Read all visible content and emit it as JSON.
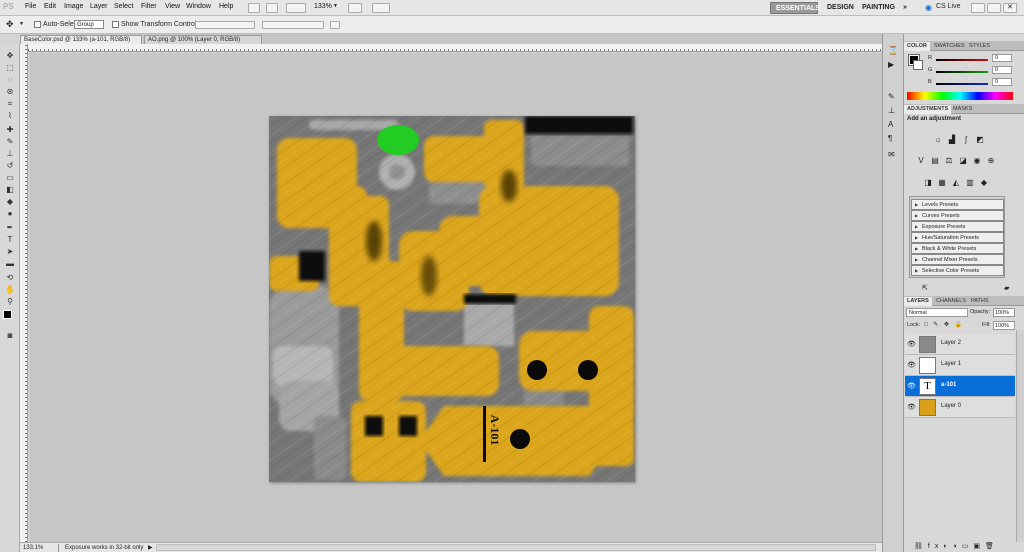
{
  "app": {
    "logo": "PS"
  },
  "menu": [
    "File",
    "Edit",
    "Image",
    "Layer",
    "Select",
    "Filter",
    "View",
    "Window",
    "Help"
  ],
  "zoom_dropdown": "133%",
  "workspaces": [
    "ESSENTIALS",
    "DESIGN",
    "PAINTING"
  ],
  "workspace_more": "»",
  "cs_live": "CS Live",
  "options": {
    "auto_select_label": "Auto-Select:",
    "auto_select_value": "Group",
    "transform_label": "Show Transform Controls"
  },
  "tabs": [
    "BaseColor.psd @ 133% (a-101, RGB/8)",
    "AO.png @ 100% (Layer 0, RGB/8)"
  ],
  "status": {
    "zoom": "133.1%",
    "message": "Exposure works in 32-bit only"
  },
  "color_panel": {
    "tabs": [
      "COLOR",
      "SWATCHES",
      "STYLES"
    ],
    "channels": [
      {
        "label": "R",
        "value": "0",
        "color": "#d01010"
      },
      {
        "label": "G",
        "value": "0",
        "color": "#10a010"
      },
      {
        "label": "B",
        "value": "0",
        "color": "#1030d0"
      }
    ]
  },
  "adjustments_panel": {
    "tabs": [
      "ADJUSTMENTS",
      "MASKS"
    ],
    "heading": "Add an adjustment",
    "icon_rows": [
      [
        "brightness-icon",
        "levels-icon",
        "curves-icon",
        "exposure-icon"
      ],
      [
        "vibrance-icon",
        "hue-sat-icon",
        "color-balance-icon",
        "black-white-icon",
        "photo-filter-icon",
        "channel-mixer-icon"
      ],
      [
        "invert-icon",
        "posterize-icon",
        "threshold-icon",
        "gradient-map-icon",
        "selective-color-icon"
      ]
    ],
    "presets": [
      "Levels Presets",
      "Curves Presets",
      "Exposure Presets",
      "Hue/Saturation Presets",
      "Black & White Presets",
      "Channel Mixer Presets",
      "Selective Color Presets"
    ]
  },
  "layers_panel": {
    "tabs": [
      "LAYERS",
      "CHANNELS",
      "PATHS"
    ],
    "blend_mode": "Normal",
    "opacity_label": "Opacity:",
    "opacity": "100%",
    "lock_label": "Lock:",
    "fill_label": "Fill:",
    "fill": "100%",
    "layers": [
      {
        "name": "Layer 2",
        "thumb": "grey"
      },
      {
        "name": "Layer 1",
        "thumb": "sparse"
      },
      {
        "name": "a-101",
        "thumb": "text",
        "selected": true
      },
      {
        "name": "Layer 0",
        "thumb": "yellow"
      }
    ]
  },
  "document": {
    "decal_text": "A-101"
  },
  "colors": {
    "accent": "#0a6ed8",
    "texture_yellow": "#dba51a",
    "texture_grey": "#7a7a7a",
    "highlight_green": "#22cc22"
  }
}
